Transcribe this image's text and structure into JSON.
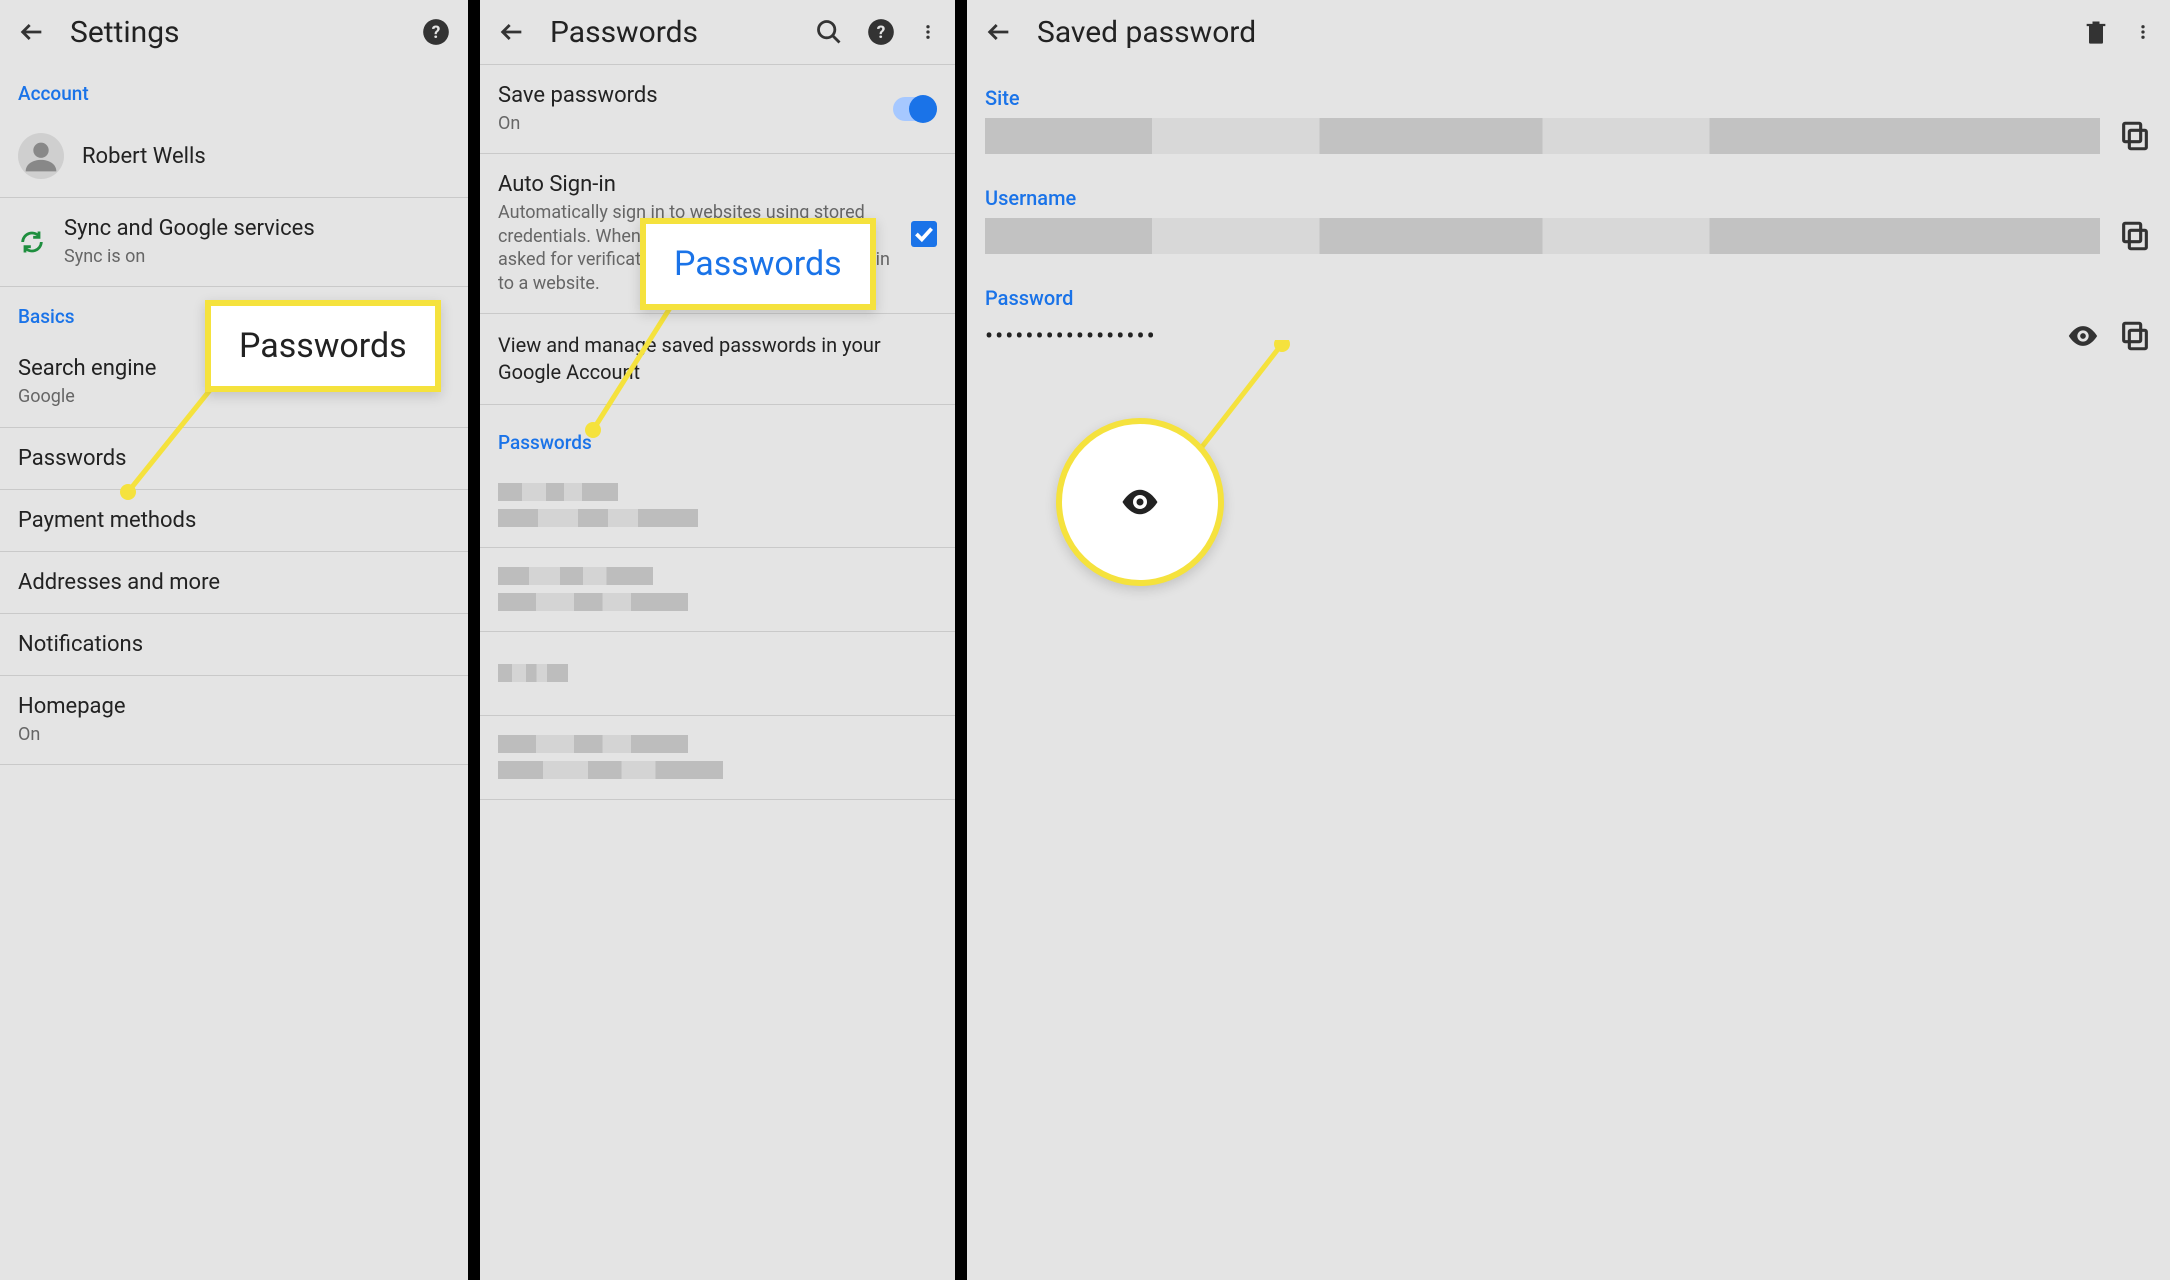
{
  "panel1": {
    "title": "Settings",
    "section_account": "Account",
    "user_name": "Robert Wells",
    "sync_title": "Sync and Google services",
    "sync_sub": "Sync is on",
    "section_basics": "Basics",
    "search_engine": "Search engine",
    "search_engine_sub": "Google",
    "passwords": "Passwords",
    "payment": "Payment methods",
    "addresses": "Addresses and more",
    "notifications": "Notifications",
    "homepage": "Homepage",
    "homepage_sub": "On"
  },
  "panel2": {
    "title": "Passwords",
    "save_pw": "Save passwords",
    "save_pw_sub": "On",
    "auto_title": "Auto Sign-in",
    "auto_sub": "Automatically sign in to websites using stored credentials. When the feature is off, you'll be asked for verification every time before signing in to a website.",
    "manage_pre": "View and manage saved passwords in your ",
    "manage_link": "Google Account",
    "pwd_header": "Passwords"
  },
  "panel3": {
    "title": "Saved password",
    "site_label": "Site",
    "user_label": "Username",
    "pw_label": "Password",
    "pw_masked": "•••••••••••••••••"
  },
  "callouts": {
    "c1": "Passwords",
    "c2": "Passwords"
  }
}
